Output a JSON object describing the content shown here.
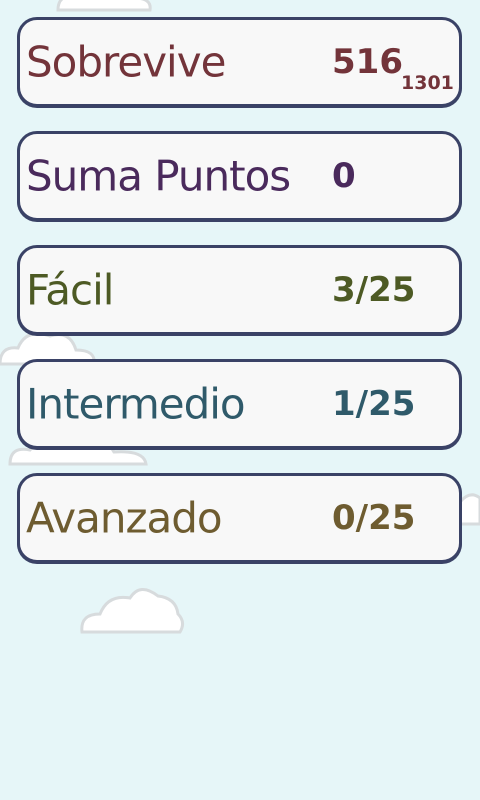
{
  "colors": {
    "background": "#e6f6f8",
    "card_fill": "#f8f8f8",
    "card_border": "#3a4266"
  },
  "modes": [
    {
      "label": "Sobrevive",
      "score": "516",
      "best": "1301",
      "color": "#73343a"
    },
    {
      "label": "Suma Puntos",
      "score": "0",
      "color": "#4a2a5c"
    },
    {
      "label": "Fácil",
      "score": "3/25",
      "color": "#4d5a24"
    },
    {
      "label": "Intermedio",
      "score": "1/25",
      "color": "#2f5a6a"
    },
    {
      "label": "Avanzado",
      "score": "0/25",
      "color": "#6e5c30"
    }
  ]
}
